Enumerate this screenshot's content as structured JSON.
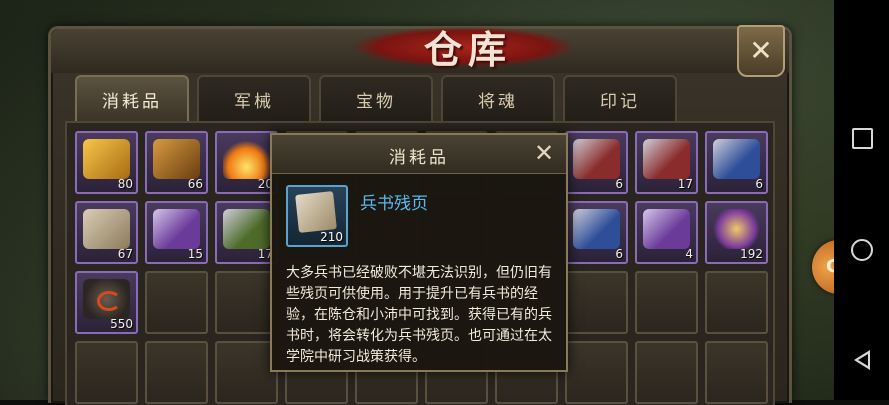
{
  "window": {
    "title": "仓库",
    "close_label": "✕"
  },
  "tabs": [
    {
      "label": "消耗品",
      "active": true
    },
    {
      "label": "军械",
      "active": false
    },
    {
      "label": "宝物",
      "active": false
    },
    {
      "label": "将魂",
      "active": false
    },
    {
      "label": "印记",
      "active": false
    }
  ],
  "grid": {
    "row1": [
      {
        "icon": "gold-scroll-icon",
        "count": "80"
      },
      {
        "icon": "wood-scroll-icon",
        "count": "66"
      },
      {
        "icon": "fire-icon",
        "count": "20"
      },
      {
        "icon": "",
        "count": ""
      },
      {
        "icon": "",
        "count": ""
      },
      {
        "icon": "",
        "count": ""
      },
      {
        "icon": "",
        "count": ""
      },
      {
        "icon": "token-red-icon",
        "count": "6"
      },
      {
        "icon": "token-red-icon",
        "count": "17"
      },
      {
        "icon": "token-blue-icon",
        "count": "6"
      }
    ],
    "row2": [
      {
        "icon": "paper-icon",
        "count": "67"
      },
      {
        "icon": "token-purple-icon",
        "count": "15"
      },
      {
        "icon": "token-green-icon",
        "count": "17"
      },
      {
        "icon": "",
        "count": ""
      },
      {
        "icon": "",
        "count": ""
      },
      {
        "icon": "",
        "count": ""
      },
      {
        "icon": "",
        "count": ""
      },
      {
        "icon": "token-blue-icon",
        "count": "6"
      },
      {
        "icon": "token-purple-icon",
        "count": "4"
      },
      {
        "icon": "seal-icon",
        "count": "192"
      }
    ],
    "row3": [
      {
        "icon": "rock-icon",
        "count": "550"
      }
    ]
  },
  "tooltip": {
    "header": "消耗品",
    "close_label": "✕",
    "item_name": "兵书残页",
    "item_count": "210",
    "description": "大多兵书已经破败不堪无法识别，但仍旧有些残页可供使用。用于提升已有兵书的经验，在陈仓和小沛中可找到。获得已有的兵书时，将会转化为兵书残页。也可通过在太学院中研习战策获得。"
  },
  "side_handle": {
    "label": "G"
  },
  "colors": {
    "accent_title": "#a8251c",
    "item_name": "#5ab8ee",
    "slot_border_item": "#8a6bb8"
  }
}
